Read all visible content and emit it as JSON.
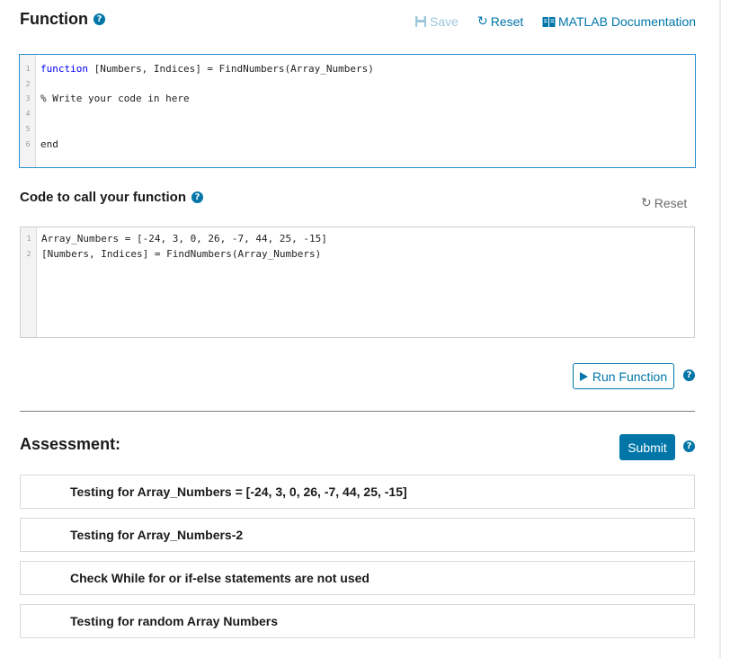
{
  "function_section": {
    "title": "Function",
    "toolbar": {
      "save_label": "Save",
      "reset_label": "Reset",
      "docs_label": "MATLAB Documentation"
    }
  },
  "function_editor": {
    "lines": [
      {
        "num": "1",
        "kw": "function",
        "text": " [Numbers, Indices] = FindNumbers(Array_Numbers)",
        "comment": "",
        "end_kw": ""
      },
      {
        "num": "2",
        "kw": "",
        "text": "",
        "comment": "",
        "end_kw": ""
      },
      {
        "num": "3",
        "kw": "",
        "text": "",
        "comment": "% Write your code in here",
        "end_kw": ""
      },
      {
        "num": "4",
        "kw": "",
        "text": "",
        "comment": "",
        "end_kw": ""
      },
      {
        "num": "5",
        "kw": "",
        "text": "",
        "comment": "",
        "end_kw": ""
      },
      {
        "num": "6",
        "kw": "",
        "text": "",
        "comment": "",
        "end_kw": "end"
      }
    ]
  },
  "call_section": {
    "title": "Code to call your function",
    "reset_label": "Reset"
  },
  "call_editor": {
    "lines": [
      {
        "num": "1",
        "text": "Array_Numbers = [-24, 3, 0, 26, -7, 44, 25, -15]"
      },
      {
        "num": "2",
        "text": "[Numbers, Indices] = FindNumbers(Array_Numbers)"
      }
    ]
  },
  "run_button_label": "Run Function",
  "assessment": {
    "title": "Assessment:",
    "submit_label": "Submit",
    "tests": [
      {
        "label": "Testing for Array_Numbers = [-24, 3, 0, 26, -7, 44, 25, -15]"
      },
      {
        "label": "Testing for Array_Numbers-2"
      },
      {
        "label": "Check While for or if-else statements are not used"
      },
      {
        "label": "Testing for random Array Numbers"
      }
    ]
  },
  "icons": {
    "help": "help-circle-icon",
    "save": "floppy-disk-icon",
    "reset": "refresh-icon",
    "docs": "book-icon",
    "run": "play-icon"
  },
  "colors": {
    "accent": "#0076a8",
    "editor_focus_border": "#2a8fd0",
    "comment": "#228b22",
    "keyword": "#0000ff"
  }
}
